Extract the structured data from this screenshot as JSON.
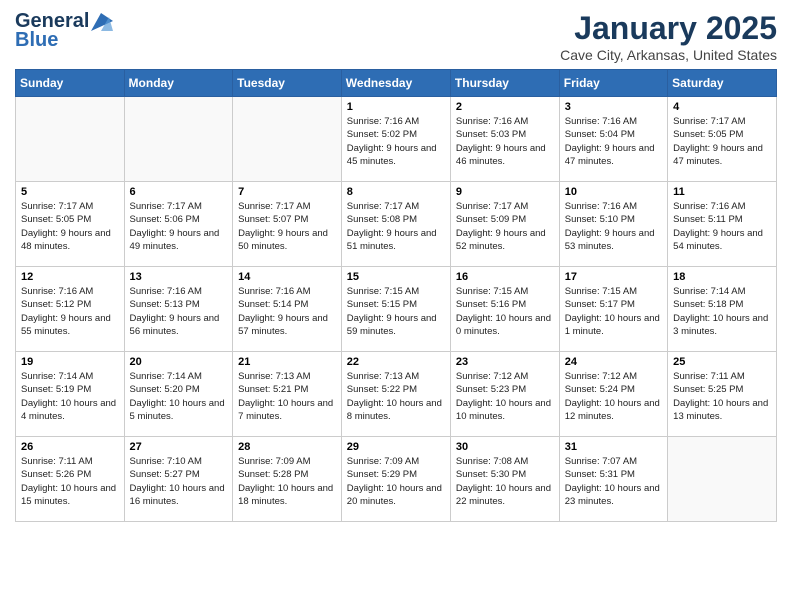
{
  "logo": {
    "line1": "General",
    "line2": "Blue"
  },
  "header": {
    "month": "January 2025",
    "location": "Cave City, Arkansas, United States"
  },
  "weekdays": [
    "Sunday",
    "Monday",
    "Tuesday",
    "Wednesday",
    "Thursday",
    "Friday",
    "Saturday"
  ],
  "weeks": [
    [
      {
        "day": "",
        "info": ""
      },
      {
        "day": "",
        "info": ""
      },
      {
        "day": "",
        "info": ""
      },
      {
        "day": "1",
        "info": "Sunrise: 7:16 AM\nSunset: 5:02 PM\nDaylight: 9 hours and 45 minutes."
      },
      {
        "day": "2",
        "info": "Sunrise: 7:16 AM\nSunset: 5:03 PM\nDaylight: 9 hours and 46 minutes."
      },
      {
        "day": "3",
        "info": "Sunrise: 7:16 AM\nSunset: 5:04 PM\nDaylight: 9 hours and 47 minutes."
      },
      {
        "day": "4",
        "info": "Sunrise: 7:17 AM\nSunset: 5:05 PM\nDaylight: 9 hours and 47 minutes."
      }
    ],
    [
      {
        "day": "5",
        "info": "Sunrise: 7:17 AM\nSunset: 5:05 PM\nDaylight: 9 hours and 48 minutes."
      },
      {
        "day": "6",
        "info": "Sunrise: 7:17 AM\nSunset: 5:06 PM\nDaylight: 9 hours and 49 minutes."
      },
      {
        "day": "7",
        "info": "Sunrise: 7:17 AM\nSunset: 5:07 PM\nDaylight: 9 hours and 50 minutes."
      },
      {
        "day": "8",
        "info": "Sunrise: 7:17 AM\nSunset: 5:08 PM\nDaylight: 9 hours and 51 minutes."
      },
      {
        "day": "9",
        "info": "Sunrise: 7:17 AM\nSunset: 5:09 PM\nDaylight: 9 hours and 52 minutes."
      },
      {
        "day": "10",
        "info": "Sunrise: 7:16 AM\nSunset: 5:10 PM\nDaylight: 9 hours and 53 minutes."
      },
      {
        "day": "11",
        "info": "Sunrise: 7:16 AM\nSunset: 5:11 PM\nDaylight: 9 hours and 54 minutes."
      }
    ],
    [
      {
        "day": "12",
        "info": "Sunrise: 7:16 AM\nSunset: 5:12 PM\nDaylight: 9 hours and 55 minutes."
      },
      {
        "day": "13",
        "info": "Sunrise: 7:16 AM\nSunset: 5:13 PM\nDaylight: 9 hours and 56 minutes."
      },
      {
        "day": "14",
        "info": "Sunrise: 7:16 AM\nSunset: 5:14 PM\nDaylight: 9 hours and 57 minutes."
      },
      {
        "day": "15",
        "info": "Sunrise: 7:15 AM\nSunset: 5:15 PM\nDaylight: 9 hours and 59 minutes."
      },
      {
        "day": "16",
        "info": "Sunrise: 7:15 AM\nSunset: 5:16 PM\nDaylight: 10 hours and 0 minutes."
      },
      {
        "day": "17",
        "info": "Sunrise: 7:15 AM\nSunset: 5:17 PM\nDaylight: 10 hours and 1 minute."
      },
      {
        "day": "18",
        "info": "Sunrise: 7:14 AM\nSunset: 5:18 PM\nDaylight: 10 hours and 3 minutes."
      }
    ],
    [
      {
        "day": "19",
        "info": "Sunrise: 7:14 AM\nSunset: 5:19 PM\nDaylight: 10 hours and 4 minutes."
      },
      {
        "day": "20",
        "info": "Sunrise: 7:14 AM\nSunset: 5:20 PM\nDaylight: 10 hours and 5 minutes."
      },
      {
        "day": "21",
        "info": "Sunrise: 7:13 AM\nSunset: 5:21 PM\nDaylight: 10 hours and 7 minutes."
      },
      {
        "day": "22",
        "info": "Sunrise: 7:13 AM\nSunset: 5:22 PM\nDaylight: 10 hours and 8 minutes."
      },
      {
        "day": "23",
        "info": "Sunrise: 7:12 AM\nSunset: 5:23 PM\nDaylight: 10 hours and 10 minutes."
      },
      {
        "day": "24",
        "info": "Sunrise: 7:12 AM\nSunset: 5:24 PM\nDaylight: 10 hours and 12 minutes."
      },
      {
        "day": "25",
        "info": "Sunrise: 7:11 AM\nSunset: 5:25 PM\nDaylight: 10 hours and 13 minutes."
      }
    ],
    [
      {
        "day": "26",
        "info": "Sunrise: 7:11 AM\nSunset: 5:26 PM\nDaylight: 10 hours and 15 minutes."
      },
      {
        "day": "27",
        "info": "Sunrise: 7:10 AM\nSunset: 5:27 PM\nDaylight: 10 hours and 16 minutes."
      },
      {
        "day": "28",
        "info": "Sunrise: 7:09 AM\nSunset: 5:28 PM\nDaylight: 10 hours and 18 minutes."
      },
      {
        "day": "29",
        "info": "Sunrise: 7:09 AM\nSunset: 5:29 PM\nDaylight: 10 hours and 20 minutes."
      },
      {
        "day": "30",
        "info": "Sunrise: 7:08 AM\nSunset: 5:30 PM\nDaylight: 10 hours and 22 minutes."
      },
      {
        "day": "31",
        "info": "Sunrise: 7:07 AM\nSunset: 5:31 PM\nDaylight: 10 hours and 23 minutes."
      },
      {
        "day": "",
        "info": ""
      }
    ]
  ]
}
